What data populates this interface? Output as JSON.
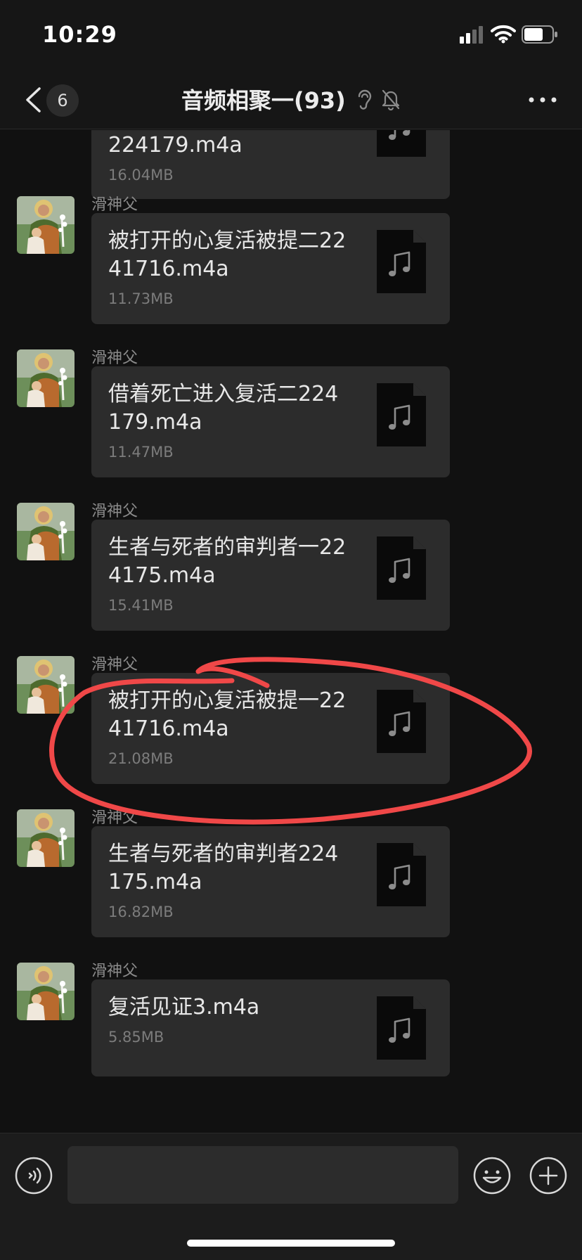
{
  "status_bar": {
    "time": "10:29"
  },
  "nav": {
    "back_badge": "6",
    "title": "音频相聚一(93)"
  },
  "colors": {
    "background": "#111111",
    "bubble": "#2c2c2c",
    "annotation": "#f04848"
  },
  "messages": [
    {
      "sender": "",
      "file_name": "224179.m4a",
      "file_size": "16.04MB",
      "avatar": "",
      "partial": true
    },
    {
      "sender": "滑神父",
      "file_name": "被打开的心复活被提二2241716.m4a",
      "file_size": "11.73MB",
      "avatar": "saint-joseph-avatar"
    },
    {
      "sender": "滑神父",
      "file_name": "借着死亡进入复活二224179.m4a",
      "file_size": "11.47MB",
      "avatar": "saint-joseph-avatar"
    },
    {
      "sender": "滑神父",
      "file_name": "生者与死者的审判者一224175.m4a",
      "file_size": "15.41MB",
      "avatar": "saint-joseph-avatar"
    },
    {
      "sender": "滑神父",
      "file_name": "被打开的心复活被提一2241716.m4a",
      "file_size": "21.08MB",
      "avatar": "saint-joseph-avatar",
      "highlighted": true
    },
    {
      "sender": "滑神父",
      "file_name": "生者与死者的审判者224175.m4a",
      "file_size": "16.82MB",
      "avatar": "saint-joseph-avatar"
    },
    {
      "sender": "滑神父",
      "file_name": "复活见证3.m4a",
      "file_size": "5.85MB",
      "avatar": "saint-joseph-avatar"
    }
  ],
  "input": {
    "value": ""
  },
  "icons": {
    "back": "chevron-left-icon",
    "ear": "ear-icon",
    "mute": "bell-mute-icon",
    "more": "more-dots-icon",
    "file": "audio-file-icon",
    "voice": "voice-icon",
    "emoji": "emoji-icon",
    "plus": "plus-icon"
  }
}
